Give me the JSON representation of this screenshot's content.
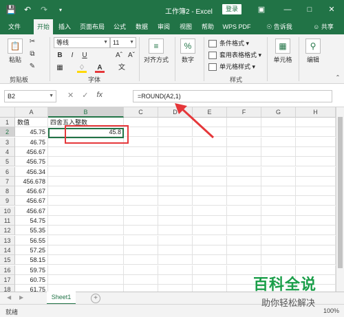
{
  "titlebar": {
    "title": "工作簿2  -  Excel",
    "login": "登录",
    "icons": [
      "save-icon",
      "undo-icon",
      "redo-icon",
      "customize-icon"
    ],
    "window": [
      "restore-ribbon-icon",
      "minimize-icon",
      "maximize-icon",
      "close-icon"
    ]
  },
  "tabs": {
    "items": [
      "文件",
      "开始",
      "插入",
      "页面布局",
      "公式",
      "数据",
      "审阅",
      "视图",
      "帮助",
      "WPS PDF",
      "告诉我",
      "共享"
    ],
    "active": "开始"
  },
  "ribbon": {
    "clipboard": {
      "paste": "粘贴",
      "label": "剪贴板"
    },
    "font": {
      "name": "等线",
      "size": "11",
      "label": "字体",
      "font_color": "#e5373a",
      "fill_color": "#ffd800"
    },
    "alignment": {
      "label": "对齐方式"
    },
    "number": {
      "label": "数字"
    },
    "styles": {
      "cond": "条件格式",
      "table": "套用表格格式",
      "cell": "单元格样式",
      "label": "样式"
    },
    "cells": {
      "label": "单元格"
    },
    "editing": {
      "label": "编辑"
    }
  },
  "formula_bar": {
    "name_box": "B2",
    "fx": "fx",
    "formula": "=ROUND(A2,1)"
  },
  "grid": {
    "columns": [
      "A",
      "B",
      "C",
      "D",
      "E",
      "F",
      "G",
      "H"
    ],
    "rows": [
      "1",
      "2",
      "3",
      "4",
      "5",
      "6",
      "7",
      "8",
      "9",
      "10",
      "11",
      "12",
      "13",
      "14",
      "15",
      "16",
      "17",
      "18"
    ],
    "col_a": [
      "数值",
      "45.75",
      "46.75",
      "456.67",
      "456.75",
      "456.34",
      "456.678",
      "456.67",
      "456.67",
      "456.67",
      "54.75",
      "55.35",
      "56.55",
      "57.25",
      "58.15",
      "59.75",
      "60.75",
      "61.75"
    ],
    "col_b": [
      "四舍五入整数",
      "45.8",
      "",
      "",
      "",
      "",
      "",
      "",
      "",
      "",
      "",
      "",
      "",
      "",
      "",
      "",
      "",
      ""
    ],
    "selected_col": "B",
    "selected_row": "2"
  },
  "sheets": {
    "tabs": [
      "Sheet1"
    ],
    "active": "Sheet1"
  },
  "status": {
    "ready": "就绪",
    "zoom": "100%"
  },
  "colors": {
    "accent": "#217346",
    "annotation": "#e5373a"
  },
  "watermark": {
    "main": "百科全说",
    "sub": "助你轻松解决"
  }
}
